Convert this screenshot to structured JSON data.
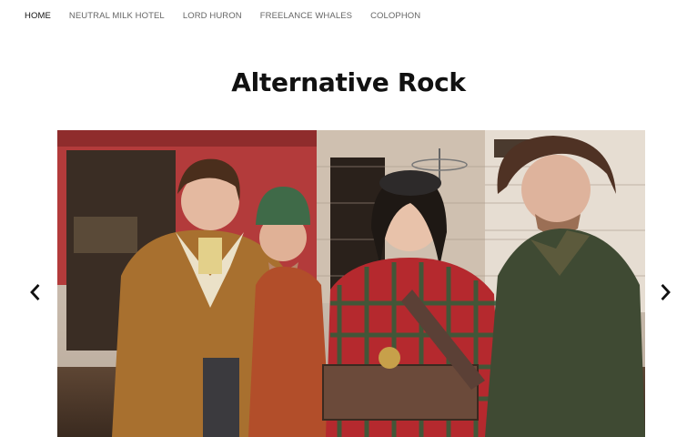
{
  "nav": {
    "items": [
      {
        "label": "HOME",
        "active": true
      },
      {
        "label": "NEUTRAL MILK HOTEL",
        "active": false
      },
      {
        "label": "LORD HURON",
        "active": false
      },
      {
        "label": "FREELANCE WHALES",
        "active": false
      },
      {
        "label": "COLOPHON",
        "active": false
      }
    ]
  },
  "page": {
    "title": "Alternative Rock"
  },
  "slider": {
    "image": "band-photo",
    "prev_icon": "chevron-left-icon",
    "next_icon": "chevron-right-icon"
  },
  "colors": {
    "nav_active": "#111111",
    "nav_inactive": "#666666",
    "title": "#111111",
    "arrow": "#111111"
  }
}
